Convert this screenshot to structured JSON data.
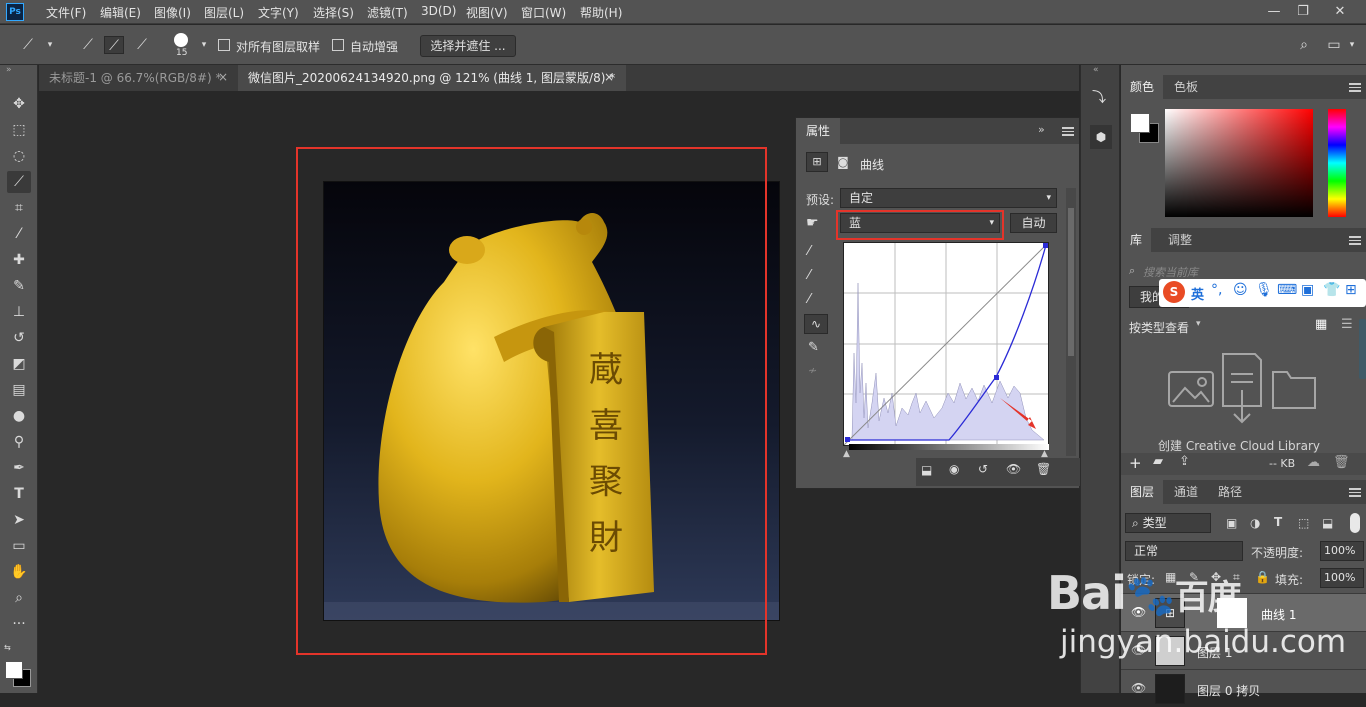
{
  "app": {
    "logo_text": "Ps"
  },
  "menu": [
    "文件(F)",
    "编辑(E)",
    "图像(I)",
    "图层(L)",
    "文字(Y)",
    "选择(S)",
    "滤镜(T)",
    "3D(D)",
    "视图(V)",
    "窗口(W)",
    "帮助(H)"
  ],
  "window_controls": {
    "minimize": "—",
    "restore": "❐",
    "close": "✕"
  },
  "options_bar": {
    "brush_size": "15",
    "sample_all_layers": "对所有图层取样",
    "auto_enhance": "自动增强",
    "select_and_mask": "选择并遮住 ..."
  },
  "tabs": [
    {
      "label": "未标题-1 @ 66.7%(RGB/8#) *",
      "close": "×"
    },
    {
      "label": "微信图片_20200624134920.png @ 121% (曲线 1, 图层蒙版/8) *",
      "close": "×"
    }
  ],
  "properties": {
    "tab": "属性",
    "panel_type": "曲线",
    "preset_label": "预设:",
    "preset_value": "自定",
    "channel_value": "蓝",
    "auto_button": "自动"
  },
  "color_panel": {
    "tabs": [
      "颜色",
      "色板"
    ],
    "foreground": "#ffffff",
    "background": "#000000"
  },
  "library_panel": {
    "tabs": [
      "库",
      "调整"
    ],
    "search_placeholder": "搜索当前库",
    "library_name": "我的",
    "ime_label": "英",
    "view_by_type": "按类型查看",
    "create_text": "创建 Creative Cloud Library",
    "kb": "-- KB"
  },
  "layers_panel": {
    "tabs": [
      "图层",
      "通道",
      "路径"
    ],
    "filter_label": "类型",
    "blend_mode": "正常",
    "opacity_label": "不透明度:",
    "opacity_value": "100%",
    "lock_label": "锁定:",
    "fill_label": "填充:",
    "fill_value": "100%",
    "layers": [
      {
        "name": "曲线 1"
      },
      {
        "name": "图层 1"
      },
      {
        "name": "图层 0 拷贝"
      }
    ]
  },
  "photo": {
    "seal_text": [
      "蔵",
      "喜",
      "聚",
      "財"
    ]
  },
  "watermark": {
    "brand": "Bai",
    "brand2": "百度",
    "sub": "jingyan.baidu.com"
  },
  "colors": {
    "accent_red": "#e4342a",
    "ps_blue": "#31a8ff",
    "curve_blue": "#2b2bd6",
    "gold": "#d4a31a"
  }
}
